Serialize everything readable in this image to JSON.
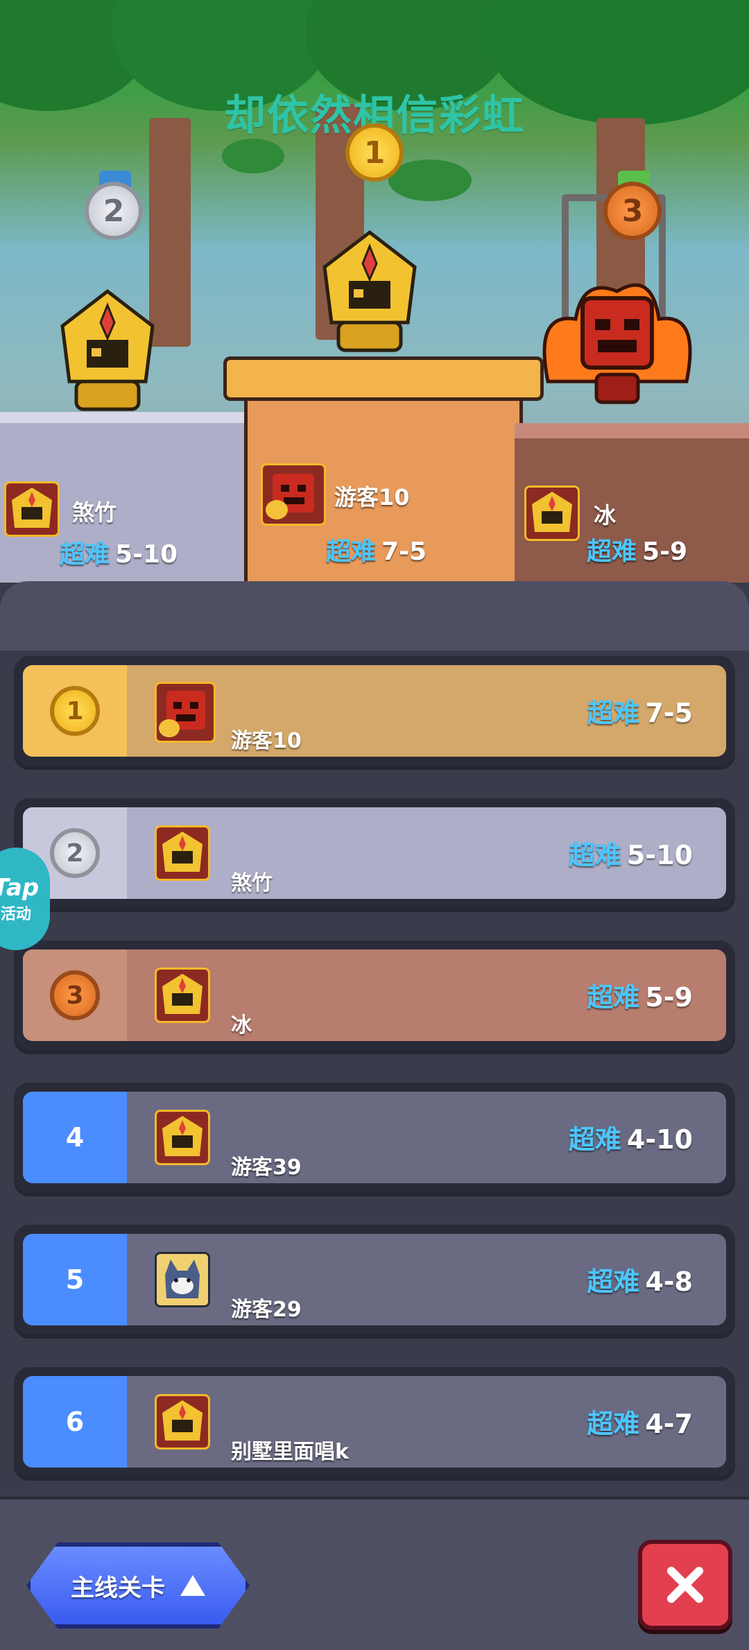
{
  "title": "却依然相信彩虹",
  "difficulty_label": "超难",
  "podium": [
    {
      "rank": "1",
      "name": "游客10",
      "level": "7-5"
    },
    {
      "rank": "2",
      "name": "煞竹",
      "level": "5-10"
    },
    {
      "rank": "3",
      "name": "冰",
      "level": "5-9"
    }
  ],
  "rows": [
    {
      "rank": "1",
      "name": "游客10",
      "level": "7-5"
    },
    {
      "rank": "2",
      "name": "煞竹",
      "level": "5-10"
    },
    {
      "rank": "3",
      "name": "冰",
      "level": "5-9"
    },
    {
      "rank": "4",
      "name": "游客39",
      "level": "4-10"
    },
    {
      "rank": "5",
      "name": "游客29",
      "level": "4-8"
    },
    {
      "rank": "6",
      "name": "别墅里面唱k",
      "level": "4-7"
    }
  ],
  "tap_badge": {
    "line1": "Tap",
    "line2": "活动"
  },
  "bottom": {
    "main_button": "主线关卡"
  },
  "colors": {
    "gold_row": "#d4a86a",
    "silver_row": "#aeaec8",
    "bronze_row": "#b77d6e",
    "normal_row": "#6a6a82",
    "rank_blue": "#4b8cff",
    "hard_text": "#4cc6ff"
  }
}
